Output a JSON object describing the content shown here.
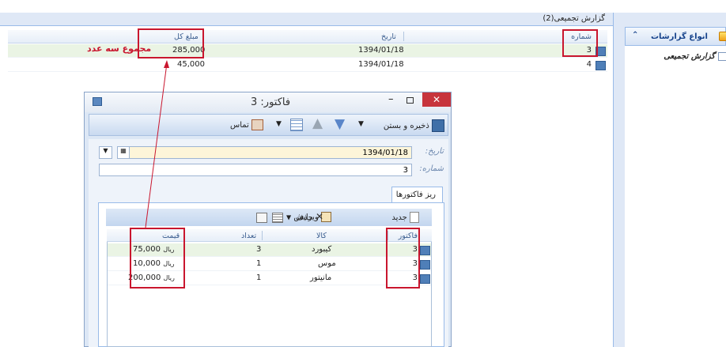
{
  "nav": {
    "section_title": "انواع گزارشات",
    "items": [
      {
        "label": "گزارش تجمیعی"
      }
    ]
  },
  "main": {
    "title": "گزارش تجمیعی(2)",
    "columns": {
      "number": "شماره",
      "date": "تاریخ",
      "total": "مبلغ کل"
    },
    "rows": [
      {
        "number": "3",
        "date": "1394/01/18",
        "total": "285,000"
      },
      {
        "number": "4",
        "date": "1394/01/18",
        "total": "45,000"
      }
    ],
    "annotation": "مجموع سه عدد"
  },
  "window": {
    "title": "فاکتور: 3",
    "toolbar": {
      "save_close": "ذخیره و بستن",
      "contact": "تماس"
    },
    "form": {
      "date_label": "تاریخ:",
      "date_value": "1394/01/18",
      "number_label": "شماره:",
      "number_value": "3"
    },
    "tab": "ریز فاکتورها",
    "sub_toolbar": {
      "new": "جدید",
      "edit": "ویرایش",
      "delete": "حذف"
    },
    "grid": {
      "columns": {
        "invoice": "فاکتور",
        "item": "کالا",
        "qty": "تعداد",
        "price": "قیمت"
      },
      "rows": [
        {
          "invoice": "3",
          "item": "کیبورد",
          "qty": "3",
          "price": "75,000",
          "unit": "ریال"
        },
        {
          "invoice": "3",
          "item": "موس",
          "qty": "1",
          "price": "10,000",
          "unit": "ریال"
        },
        {
          "invoice": "3",
          "item": "مانیتور",
          "qty": "1",
          "price": "200,000",
          "unit": "ریال"
        }
      ]
    }
  },
  "colors": {
    "accent": "#c9162e",
    "panel": "#dfe8f6",
    "border": "#99bbe8",
    "selected_row": "#eaf4e4"
  }
}
